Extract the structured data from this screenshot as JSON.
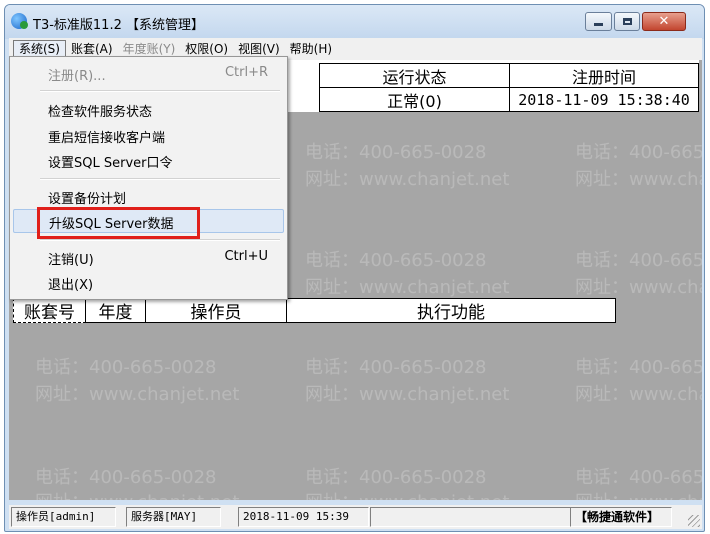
{
  "window": {
    "title": "T3-标准版11.2 【系统管理】"
  },
  "menubar": [
    {
      "label": "系统(S)",
      "state": "active"
    },
    {
      "label": "账套(A)",
      "state": "normal"
    },
    {
      "label": "年度账(Y)",
      "state": "disabled"
    },
    {
      "label": "权限(O)",
      "state": "normal"
    },
    {
      "label": "视图(V)",
      "state": "normal"
    },
    {
      "label": "帮助(H)",
      "state": "normal"
    }
  ],
  "server_table": {
    "headers": [
      "运行状态",
      "注册时间"
    ],
    "rows": [
      [
        "正常(0)",
        "2018-11-09 15:38:40"
      ]
    ]
  },
  "ops_table": {
    "headers": [
      "账套号",
      "年度",
      "操作员",
      "执行功能"
    ]
  },
  "system_menu": {
    "items": [
      {
        "label": "注册(R)...",
        "shortcut": "Ctrl+R",
        "disabled": true
      },
      {
        "label": "检查软件服务状态",
        "shortcut": ""
      },
      {
        "label": "重启短信接收客户端",
        "shortcut": ""
      },
      {
        "label": "设置SQL Server口令",
        "shortcut": ""
      },
      {
        "label": "设置备份计划",
        "shortcut": ""
      },
      {
        "label": "升级SQL Server数据",
        "shortcut": "",
        "highlighted": true
      },
      {
        "label": "注销(U)",
        "shortcut": "Ctrl+U"
      },
      {
        "label": "退出(X)",
        "shortcut": ""
      }
    ]
  },
  "watermark": {
    "phone": "电话：400-665-0028",
    "site": "网址：www.chanjet.net"
  },
  "statusbar": {
    "operator": "操作员[admin]",
    "server": "服务器[MAY]",
    "datetime": "2018-11-09 15:39",
    "vendor": "【畅捷通软件】"
  },
  "colors": {
    "highlight_box": "#e0201b",
    "client_bg": "#a6a6a6",
    "close_button": "#c2452f"
  },
  "icons": {
    "app": "app-logo-icon",
    "minimize": "minimize-icon",
    "maximize": "maximize-icon",
    "close": "close-icon",
    "grip": "resize-grip-icon"
  }
}
